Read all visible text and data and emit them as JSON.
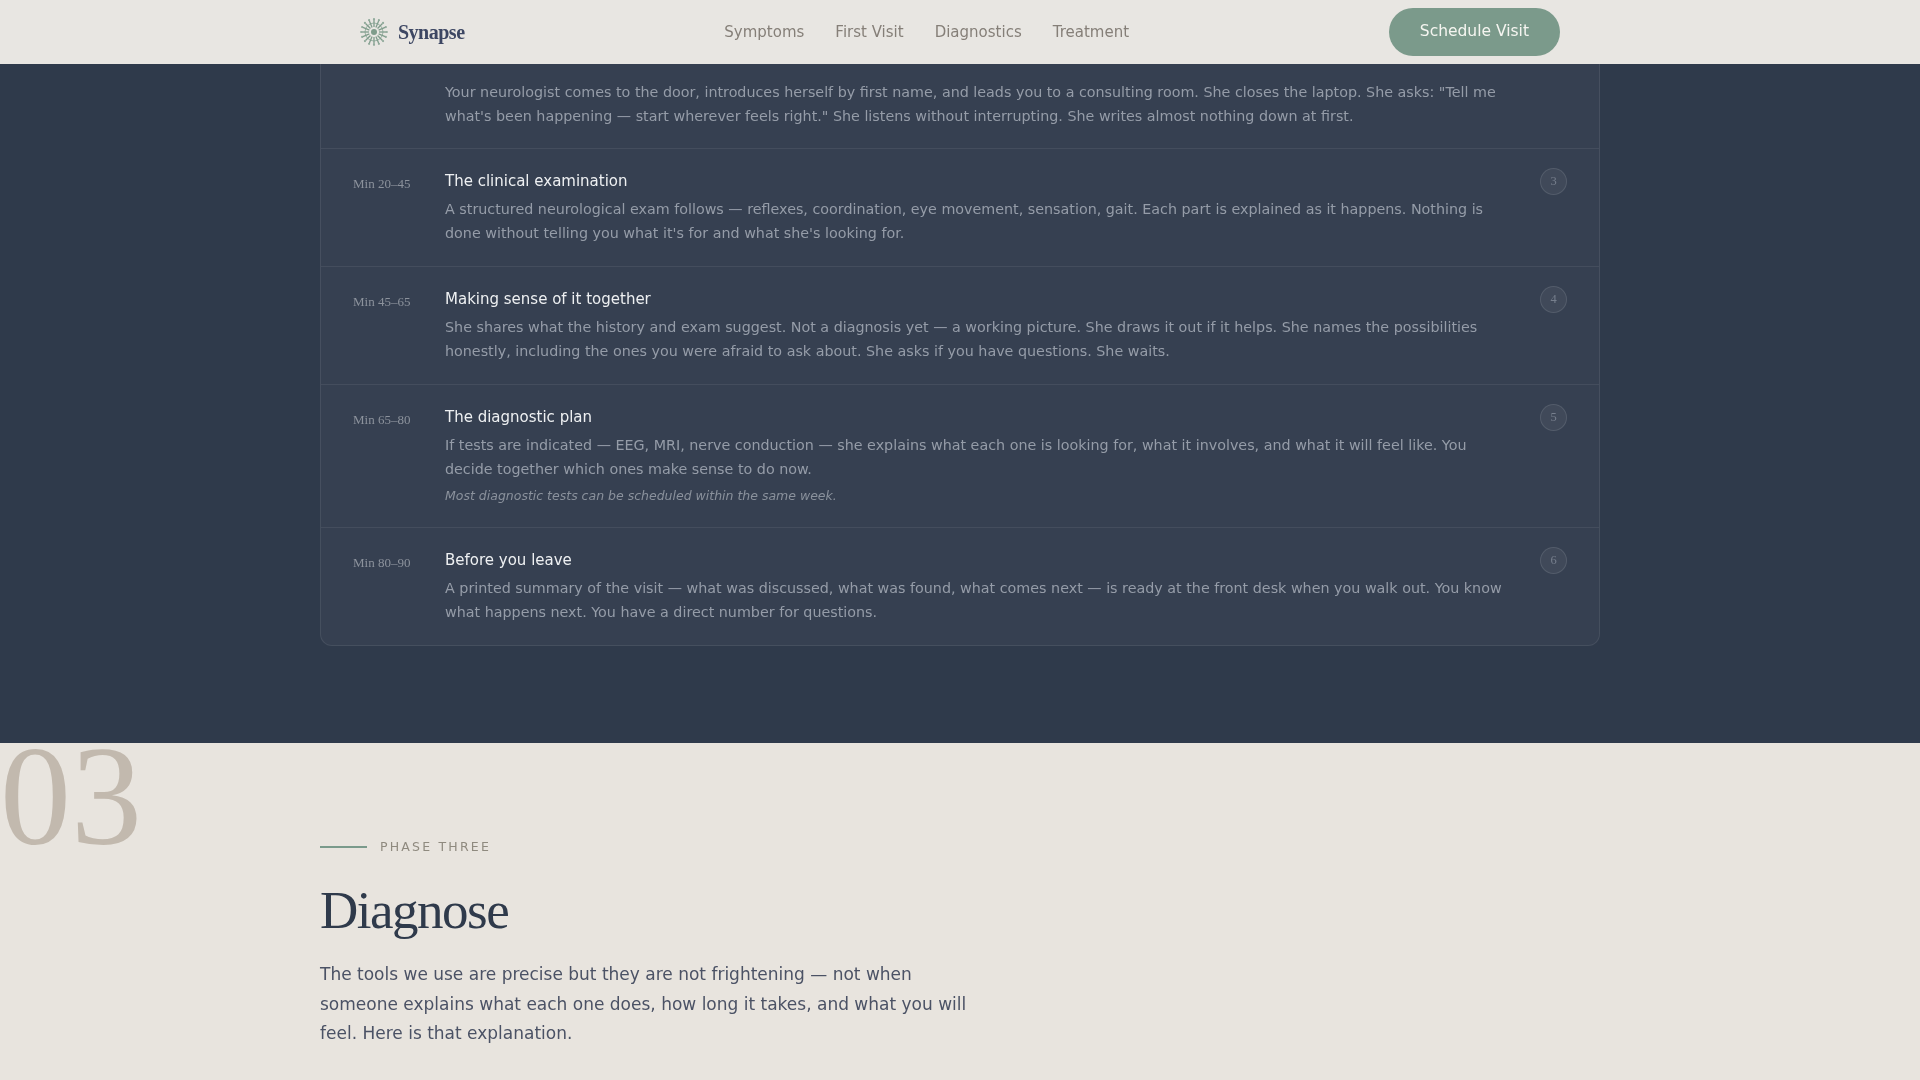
{
  "navbar": {
    "brand": "Synapse",
    "links": [
      "Symptoms",
      "First Visit",
      "Diagnostics",
      "Treatment"
    ],
    "cta": "Schedule Visit"
  },
  "timeline": {
    "steps": [
      {
        "description": "Your neurologist comes to the door, introduces herself by first name, and leads you to a consulting room. She closes the laptop. She asks: \"Tell me what's been happening — start wherever feels right.\" She listens without interrupting. She writes almost nothing down at first."
      },
      {
        "time": "Min 20–45",
        "title": "The clinical examination",
        "number": "3",
        "description": "A structured neurological exam follows — reflexes, coordination, eye movement, sensation, gait. Each part is explained as it happens. Nothing is done without telling you what it's for and what she's looking for."
      },
      {
        "time": "Min 45–65",
        "title": "Making sense of it together",
        "number": "4",
        "description": "She shares what the history and exam suggest. Not a diagnosis yet — a working picture. She draws it out if it helps. She names the possibilities honestly, including the ones you were afraid to ask about. She asks if you have questions. She waits."
      },
      {
        "time": "Min 65–80",
        "title": "The diagnostic plan",
        "number": "5",
        "description": "If tests are indicated — EEG, MRI, nerve conduction — she explains what each one is looking for, what it involves, and what it will feel like. You decide together which ones make sense to do now.",
        "note": "Most diagnostic tests can be scheduled within the same week."
      },
      {
        "time": "Min 80–90",
        "title": "Before you leave",
        "number": "6",
        "description": "A printed summary of the visit — what was discussed, what was found, what comes next — is ready at the front desk when you walk out. You know what happens next. You have a direct number for questions."
      }
    ]
  },
  "phase": {
    "number": "03",
    "eyebrow": "PHASE THREE",
    "title": "Diagnose",
    "intro": "The tools we use are precise but they are not frightening — not when someone explains what each one does, how long it takes, and what you will feel. Here is that explanation."
  }
}
